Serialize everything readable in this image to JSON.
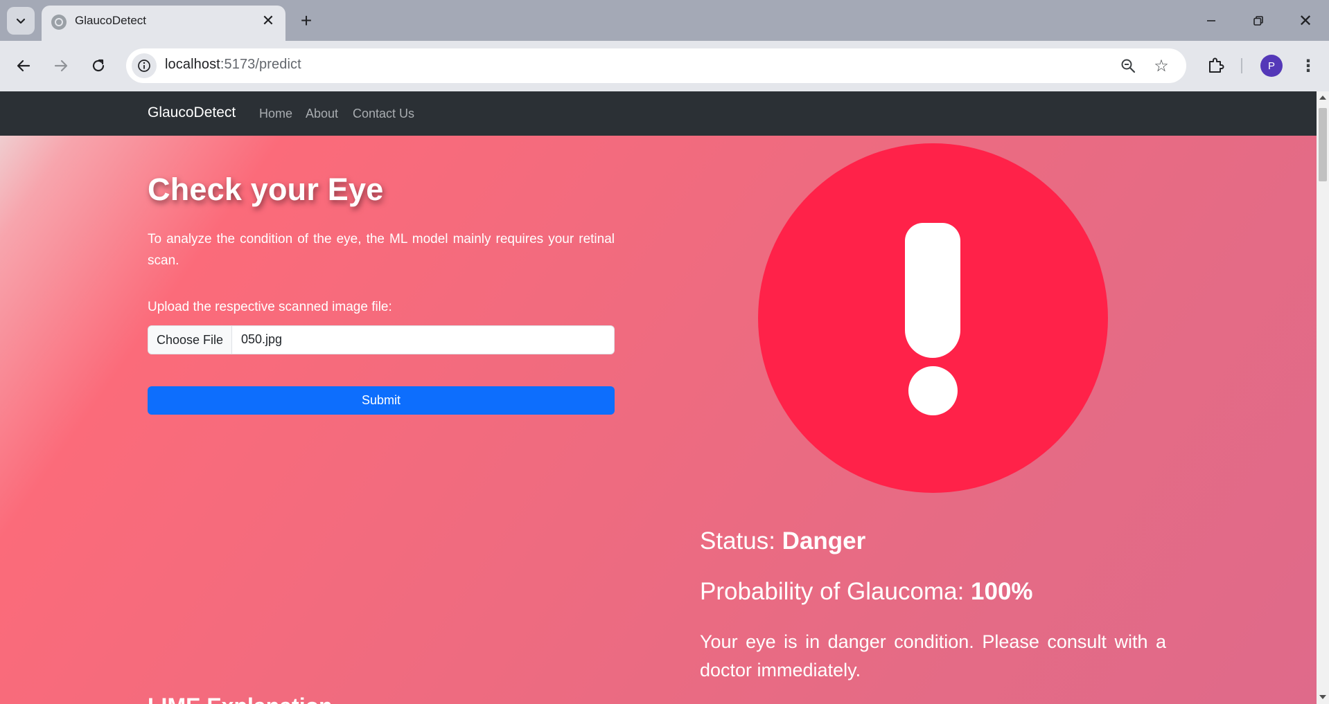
{
  "browser": {
    "tab_title": "GlaucoDetect",
    "new_tab_glyph": "+",
    "close_tab_glyph": "✕",
    "url_host": "localhost",
    "url_rest": ":5173/predict",
    "profile_initial": "P",
    "menu_glyph": "⋮",
    "star_glyph": "☆",
    "window_close_glyph": "✕"
  },
  "navbar": {
    "brand": "GlaucoDetect",
    "links": [
      "Home",
      "About",
      "Contact Us"
    ]
  },
  "form": {
    "heading": "Check your Eye",
    "intro": "To analyze the condition of the eye, the ML model mainly requires your retinal scan.",
    "upload_label": "Upload the respective scanned image file:",
    "choose_file_label": "Choose File",
    "file_name": "050.jpg",
    "submit_label": "Submit"
  },
  "result": {
    "status_label": "Status: ",
    "status_value": "Danger",
    "probability_label": "Probability of Glaucoma: ",
    "probability_value": "100%",
    "advice": "Your eye is in danger condition. Please consult with a doctor immediately.",
    "alert_color": "#ff2249",
    "alert_icon": "exclamation-icon"
  },
  "lime": {
    "heading": "LIME Explanation"
  },
  "colors": {
    "navbar_bg": "#2b3035",
    "submit_bg": "#0d6efd",
    "avatar_bg": "#5438b8"
  }
}
